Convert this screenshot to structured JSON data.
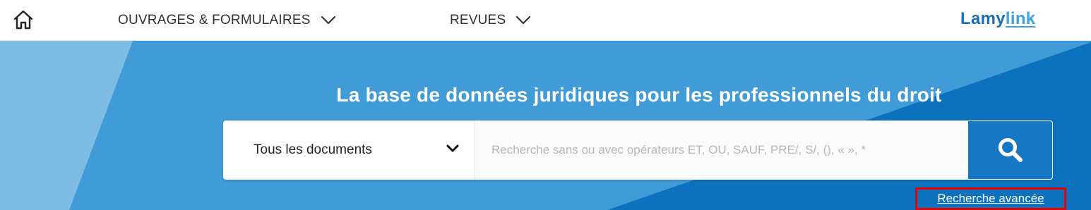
{
  "nav": {
    "home_icon": "home-icon",
    "items": [
      {
        "label": "OUVRAGES & FORMULAIRES",
        "icon": "chevron-down-icon"
      },
      {
        "label": "REVUES",
        "icon": "chevron-down-icon"
      }
    ],
    "brand": {
      "part1": "Lamy",
      "part2": "link"
    }
  },
  "hero": {
    "title": "La base de données juridiques pour les professionnels du droit",
    "colors": {
      "light": "#7dbce3",
      "mid": "#409bd6",
      "dark": "#0d72bd"
    }
  },
  "search": {
    "select_value": "Tous les documents",
    "placeholder": "Recherche sans ou avec opérateurs ET, OU, SAUF, PRE/, S/, (), « », *",
    "button_icon": "search-icon"
  },
  "advanced_search": {
    "label": "Recherche avancée"
  }
}
